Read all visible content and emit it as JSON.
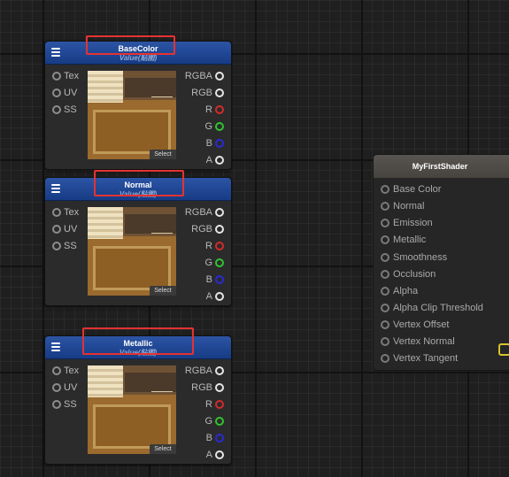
{
  "nodes": [
    {
      "title": "BaseColor",
      "subtitle": "Value(贴图)",
      "inputs": [
        "Tex",
        "UV",
        "SS"
      ],
      "outputs": [
        "RGBA",
        "RGB",
        "R",
        "G",
        "B",
        "A"
      ],
      "select_label": "Select"
    },
    {
      "title": "Normal",
      "subtitle": "Value(贴图)",
      "inputs": [
        "Tex",
        "UV",
        "SS"
      ],
      "outputs": [
        "RGBA",
        "RGB",
        "R",
        "G",
        "B",
        "A"
      ],
      "select_label": "Select"
    },
    {
      "title": "Metallic",
      "subtitle": "Value(贴图)",
      "inputs": [
        "Tex",
        "UV",
        "SS"
      ],
      "outputs": [
        "RGBA",
        "RGB",
        "R",
        "G",
        "B",
        "A"
      ],
      "select_label": "Select"
    }
  ],
  "shader_node": {
    "title": "MyFirstShader",
    "inputs": [
      "Base Color",
      "Normal",
      "Emission",
      "Metallic",
      "Smoothness",
      "Occlusion",
      "Alpha",
      "Alpha Clip Threshold",
      "Vertex Offset",
      "Vertex Normal",
      "Vertex Tangent"
    ]
  },
  "colors": {
    "node_header": "#1f4a98",
    "highlight": "#e53232",
    "shader_header": "#524e49",
    "port_r": "#d42a2a",
    "port_g": "#2fc52f",
    "port_b": "#2a2ad6"
  }
}
